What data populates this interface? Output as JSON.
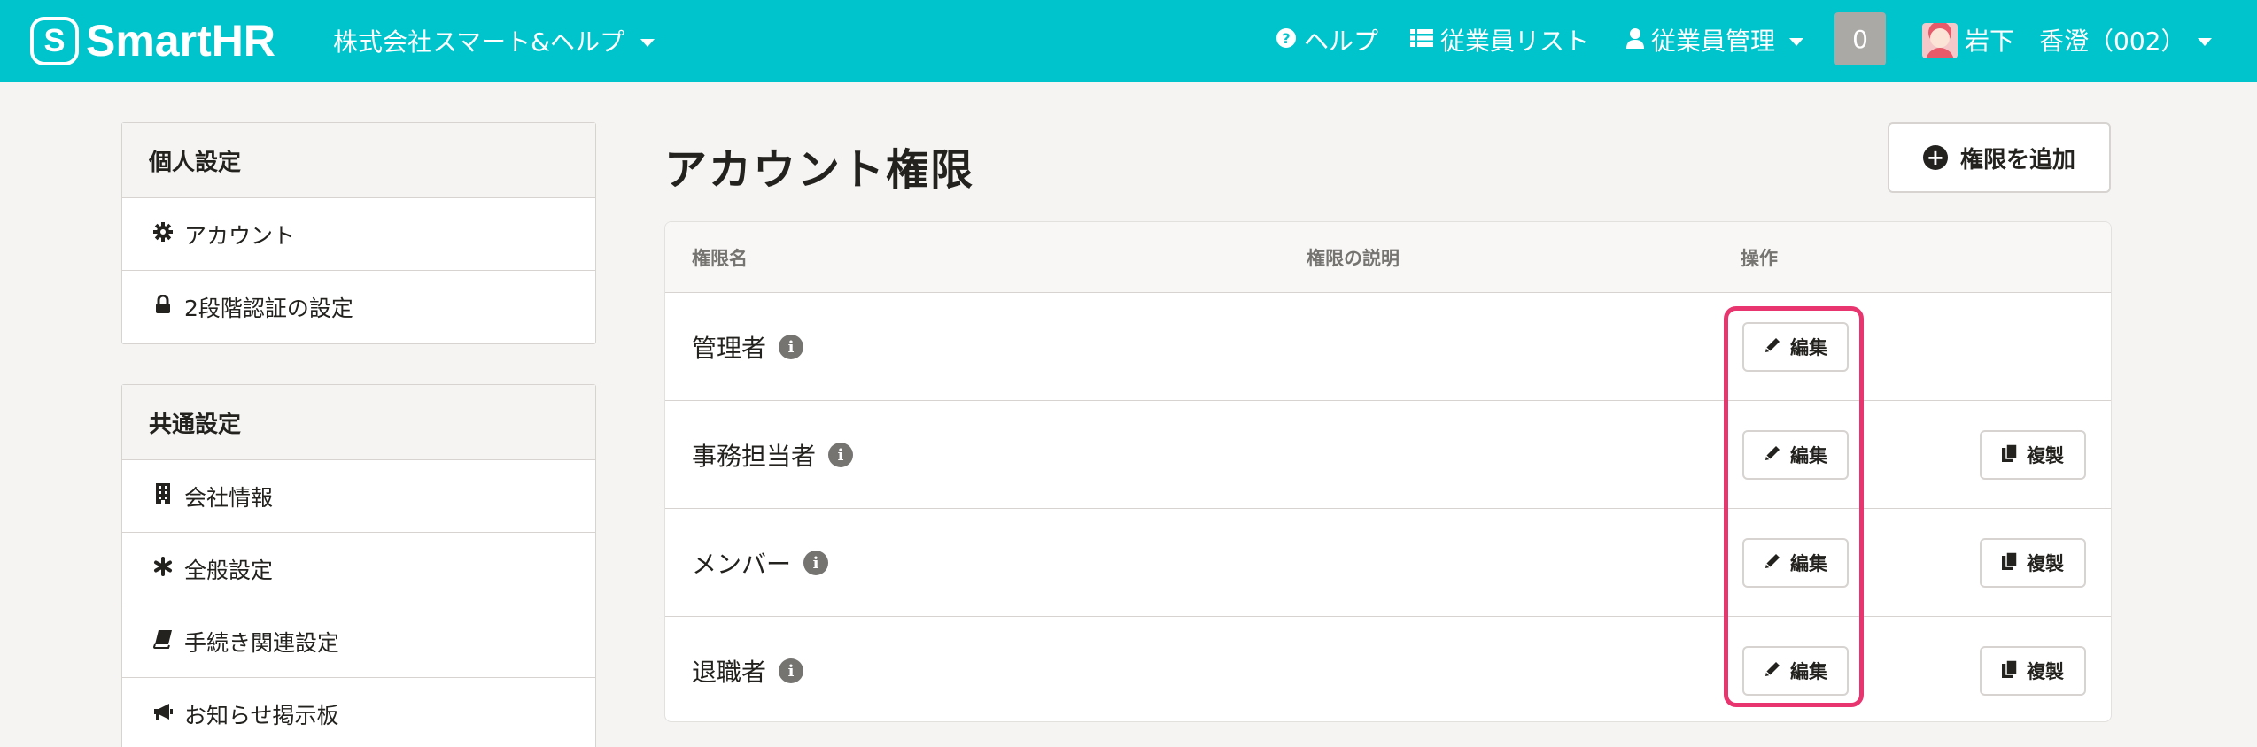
{
  "header": {
    "logo_text": "SmartHR",
    "company_name": "株式会社スマート&ヘルプ",
    "help_label": "ヘルプ",
    "employee_list_label": "従業員リスト",
    "employee_manage_label": "従業員管理",
    "notification_count": "0",
    "user_name": "岩下　香澄（002）",
    "colors": {
      "brand": "#00c4cc",
      "highlight": "#e8356f"
    }
  },
  "sidebar": {
    "personal": {
      "title": "個人設定",
      "items": [
        {
          "label": "アカウント",
          "icon": "gear-icon"
        },
        {
          "label": "2段階認証の設定",
          "icon": "lock-icon"
        }
      ]
    },
    "common": {
      "title": "共通設定",
      "items": [
        {
          "label": "会社情報",
          "icon": "building-icon"
        },
        {
          "label": "全般設定",
          "icon": "asterisk-icon"
        },
        {
          "label": "手続き関連設定",
          "icon": "book-icon"
        },
        {
          "label": "お知らせ掲示板",
          "icon": "megaphone-icon"
        }
      ]
    }
  },
  "main": {
    "title": "アカウント権限",
    "add_button_label": "権限を追加",
    "table": {
      "headers": {
        "name": "権限名",
        "description": "権限の説明",
        "actions": "操作"
      },
      "rows": [
        {
          "name": "管理者",
          "description": "",
          "edit": "編集",
          "copy": ""
        },
        {
          "name": "事務担当者",
          "description": "",
          "edit": "編集",
          "copy": "複製"
        },
        {
          "name": "メンバー",
          "description": "",
          "edit": "編集",
          "copy": "複製"
        },
        {
          "name": "退職者",
          "description": "",
          "edit": "編集",
          "copy": "複製"
        }
      ]
    }
  }
}
